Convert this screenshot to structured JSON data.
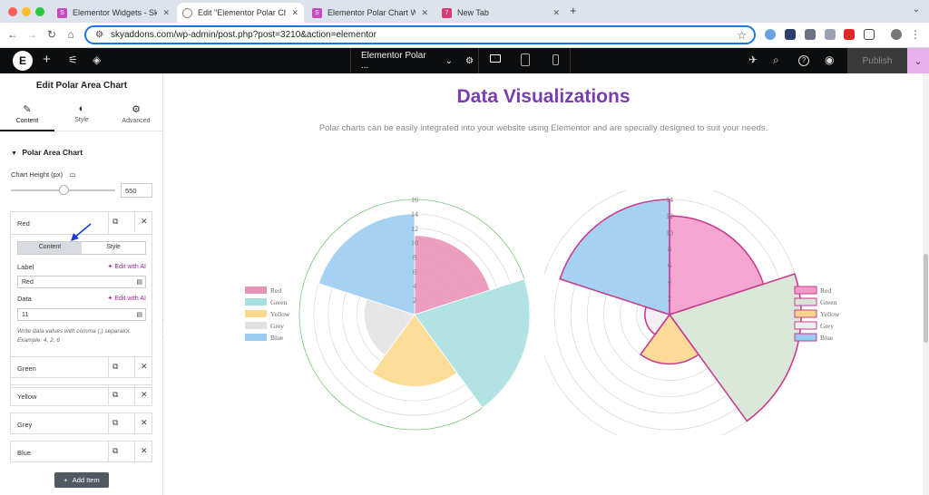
{
  "browser": {
    "tabs": [
      {
        "title": "Elementor Widgets - Sky Addons",
        "favicon": "Sk",
        "color": "#c54bbc"
      },
      {
        "title": "Edit \"Elementor Polar Chart W",
        "favicon": "globe",
        "color": "#888888"
      },
      {
        "title": "Elementor Polar Chart Widget",
        "favicon": "Sk",
        "color": "#c54bbc"
      },
      {
        "title": "New Tab",
        "favicon": "7k",
        "color": "#d93a76"
      }
    ],
    "url": "skyaddons.com/wp-admin/post.php?post=3210&action=elementor"
  },
  "editor": {
    "page_title": "Elementor Polar ...",
    "publish_label": "Publish"
  },
  "panel": {
    "title": "Edit Polar Area Chart",
    "tabs": [
      "Content",
      "Style",
      "Advanced"
    ],
    "section_title": "Polar Area Chart",
    "chart_height_label": "Chart Height (px)",
    "chart_height_value": "550",
    "slider_fraction": 0.5,
    "expanded_item": {
      "title": "Red",
      "subtabs": [
        "Content",
        "Style"
      ],
      "label_caption": "Label",
      "edit_ai": "Edit with AI",
      "label_value": "Red",
      "data_caption": "Data",
      "data_value": "11",
      "hint": "Write data values with comma (,) separator. Example: 4, 2, 6"
    },
    "items": [
      "Green",
      "Yellow",
      "Grey",
      "Blue"
    ],
    "add_item_label": "Add Item"
  },
  "page": {
    "heading": "Data Visualizations",
    "subheading": "Polar charts can be easily integrated into your website using Elementor and are specially designed to suit your needs."
  },
  "chart_data": [
    {
      "type": "polarArea",
      "categories": [
        "Red",
        "Green",
        "Yellow",
        "Grey",
        "Blue"
      ],
      "values": [
        11,
        16,
        10,
        7,
        14
      ],
      "rmax": 16,
      "ticks": [
        2,
        4,
        6,
        8,
        10,
        12,
        14,
        16
      ],
      "colors": [
        "#e891b4",
        "#a6dfe0",
        "#fbd88a",
        "#e2e2e2",
        "#99cbf0"
      ],
      "legend": "left"
    },
    {
      "type": "polarArea",
      "categories": [
        "Red",
        "Green",
        "Yellow",
        "Grey",
        "Blue"
      ],
      "values": [
        12,
        16,
        6,
        3,
        14
      ],
      "rmax": 14,
      "ticks": [
        2,
        4,
        6,
        8,
        10,
        12,
        14,
        16
      ],
      "colors": [
        "#f49ac9",
        "#d6e5d4",
        "#fcd58a",
        "#f0eef0",
        "#99cbf0"
      ],
      "stroke": "#c73d8f",
      "legend": "right"
    }
  ]
}
